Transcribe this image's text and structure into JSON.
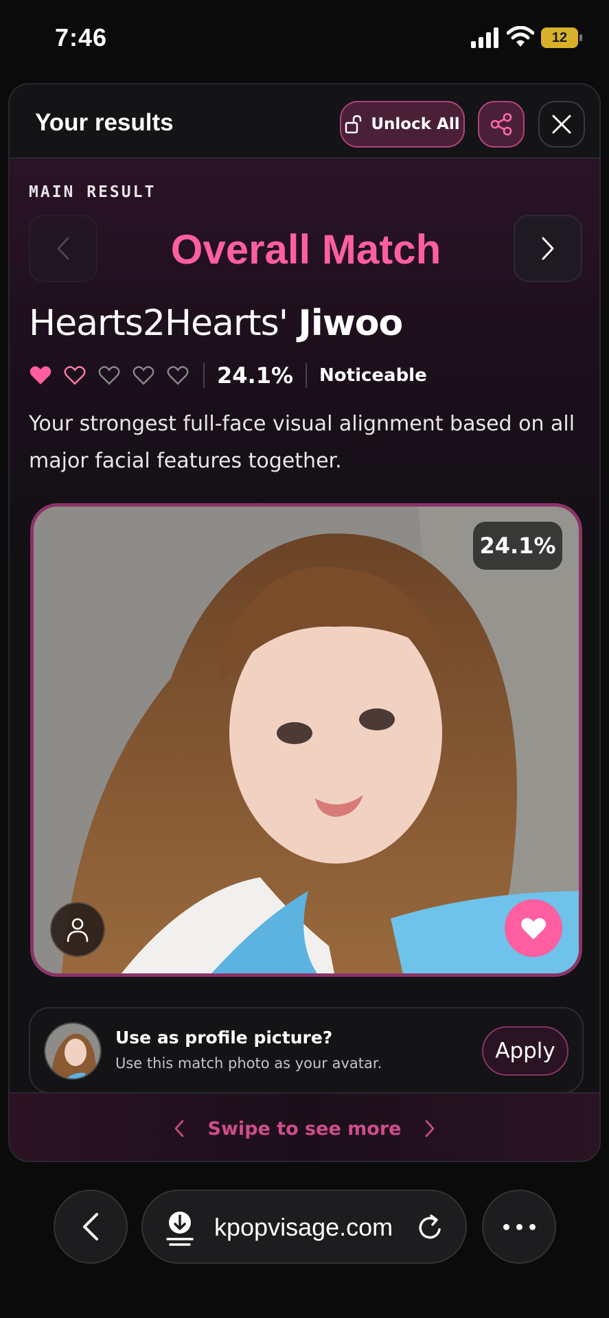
{
  "status_bar": {
    "time": "7:46",
    "battery": "12"
  },
  "modal": {
    "title": "Your results",
    "unlock_label": "Unlock All"
  },
  "result": {
    "section_label": "MAIN RESULT",
    "title": "Overall Match",
    "group": "Hearts2Hearts'",
    "member": "Jiwoo",
    "hearts_filled": 1,
    "hearts_total": 5,
    "percent": "24.1%",
    "level": "Noticeable",
    "description": "Your strongest full-face visual alignment based on all major facial features together.",
    "photo_badge": "24.1%"
  },
  "profile_prompt": {
    "question": "Use as profile picture?",
    "subtitle": "Use this match photo as your avatar.",
    "apply_label": "Apply"
  },
  "swipe": {
    "label": "Swipe to see more"
  },
  "browser": {
    "url": "kpopvisage.com"
  },
  "colors": {
    "accent": "#ff5fa0",
    "accent_dark": "#8a3468"
  }
}
